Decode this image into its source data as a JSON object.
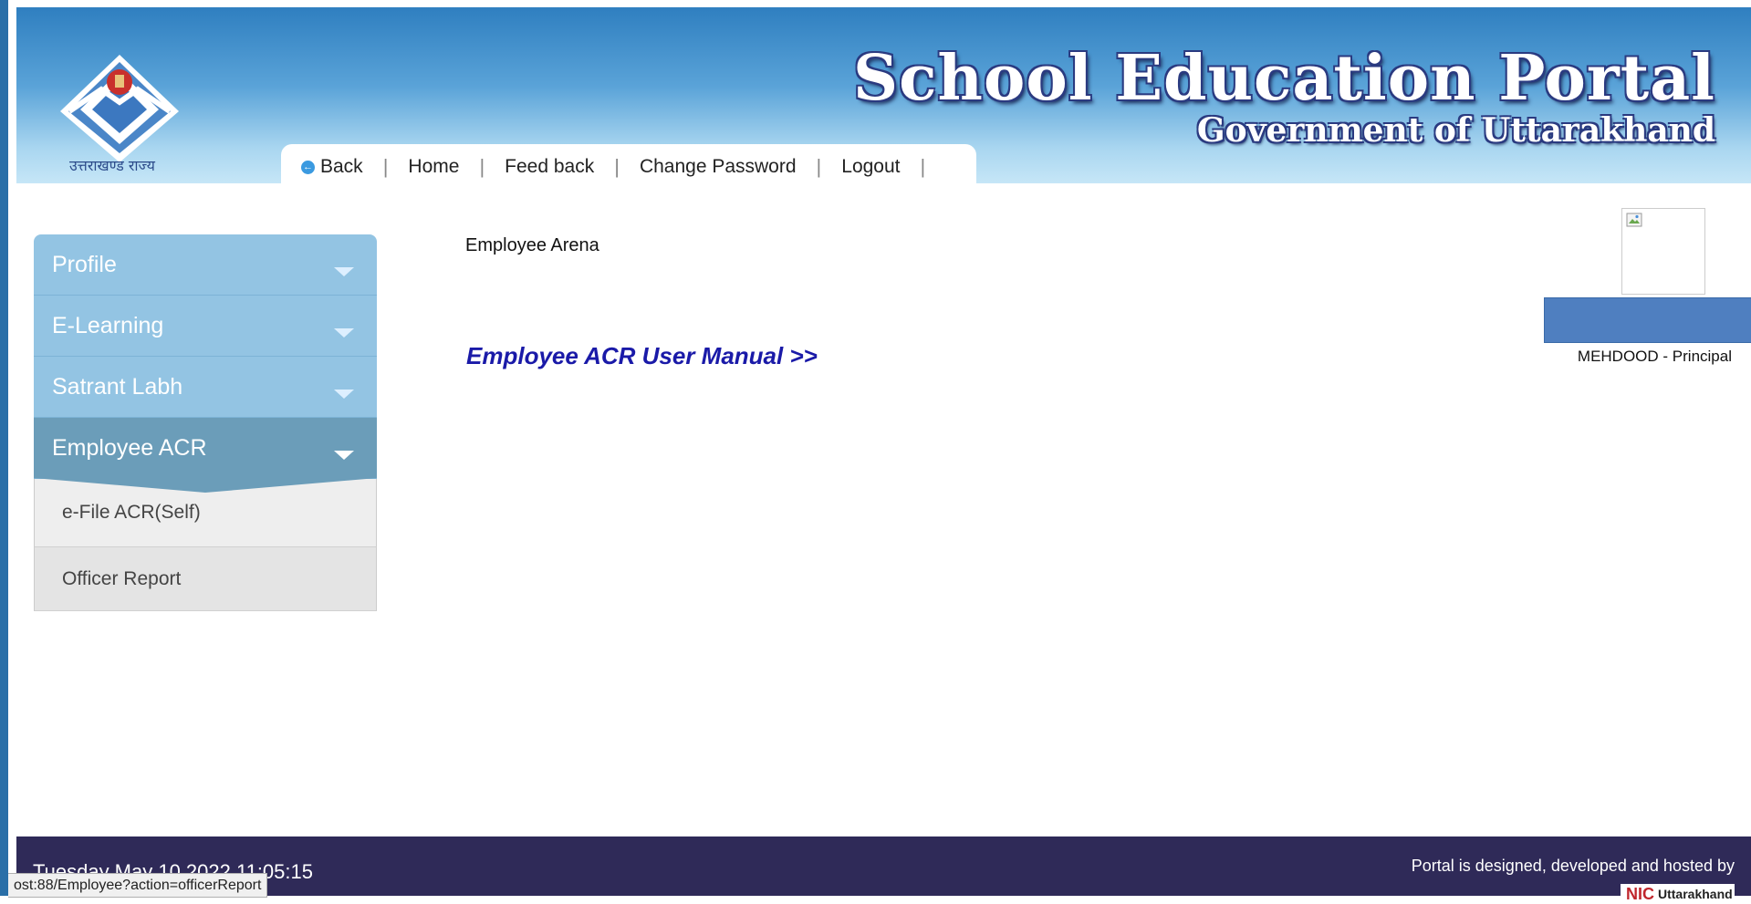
{
  "header": {
    "logo_caption": "उत्तराखण्ड राज्य",
    "portal_title": "School Education Portal",
    "portal_subtitle": "Government of Uttarakhand",
    "nav": {
      "back": "Back",
      "home": "Home",
      "feedback": "Feed back",
      "change_password": "Change Password",
      "logout": "Logout"
    }
  },
  "sidebar": {
    "items": [
      {
        "label": "Profile"
      },
      {
        "label": "E-Learning"
      },
      {
        "label": "Satrant Labh"
      },
      {
        "label": "Employee ACR",
        "active": true
      }
    ],
    "subitems": [
      {
        "label": "e-File ACR(Self)"
      },
      {
        "label": "Officer Report"
      }
    ]
  },
  "main": {
    "section_label": "Employee Arena",
    "manual_link": "Employee ACR User Manual >>"
  },
  "user": {
    "name": "MEHDOOD - Principal"
  },
  "footer": {
    "datetime": "Tuesday May 10 2022 11:05:15",
    "credits": "Portal is designed, developed and hosted by",
    "nic_logo": "NIC",
    "nic_region": "Uttarakhand"
  },
  "status_bar": {
    "url": "ost:88/Employee?action=officerReport"
  },
  "colors": {
    "header_top": "#2f7fc0",
    "sidebar_item": "#93c4e3",
    "sidebar_active": "#6b9db9",
    "footer": "#2f2a58",
    "link": "#1a1aa8"
  }
}
